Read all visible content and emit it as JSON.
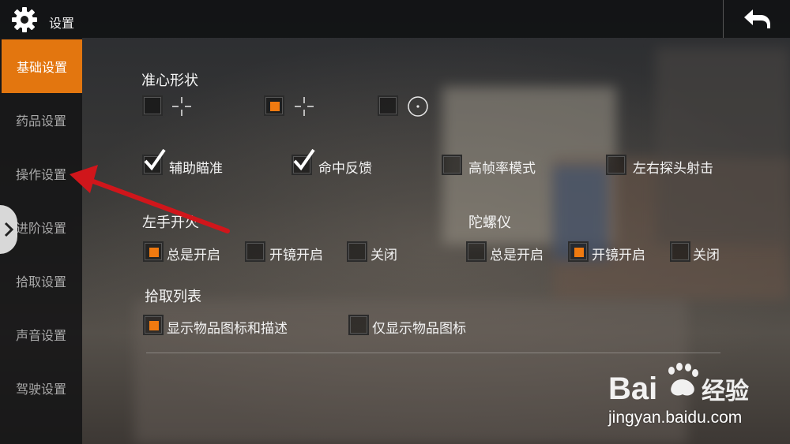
{
  "header": {
    "title": "设置",
    "back_icon": "back-arrow-icon",
    "settings_icon": "gear-icon"
  },
  "sidebar": {
    "items": [
      {
        "label": "基础设置",
        "active": true
      },
      {
        "label": "药品设置",
        "active": false
      },
      {
        "label": "操作设置",
        "active": false
      },
      {
        "label": "进阶设置",
        "active": false
      },
      {
        "label": "拾取设置",
        "active": false
      },
      {
        "label": "声音设置",
        "active": false
      },
      {
        "label": "驾驶设置",
        "active": false
      }
    ],
    "expand_icon": "chevron-right-icon"
  },
  "crosshair": {
    "title": "准心形状",
    "options": [
      {
        "icon": "crosshair-cross-icon",
        "selected": false
      },
      {
        "icon": "crosshair-cross-icon",
        "selected": true
      },
      {
        "icon": "crosshair-dot-circle-icon",
        "selected": false
      }
    ]
  },
  "toggles": [
    {
      "label": "辅助瞄准",
      "checked": true
    },
    {
      "label": "命中反馈",
      "checked": true
    },
    {
      "label": "高帧率模式",
      "checked": false
    },
    {
      "label": "左右探头射击",
      "checked": false
    }
  ],
  "left_fire": {
    "title": "左手开火",
    "options": [
      {
        "label": "总是开启",
        "selected": true
      },
      {
        "label": "开镜开启",
        "selected": false
      },
      {
        "label": "关闭",
        "selected": false
      }
    ]
  },
  "gyroscope": {
    "title": "陀螺仪",
    "options": [
      {
        "label": "总是开启",
        "selected": false
      },
      {
        "label": "开镜开启",
        "selected": true
      },
      {
        "label": "关闭",
        "selected": false
      }
    ]
  },
  "pickup_list": {
    "title": "拾取列表",
    "options": [
      {
        "label": "显示物品图标和描述",
        "selected": true
      },
      {
        "label": "仅显示物品图标",
        "selected": false
      }
    ]
  },
  "watermark": {
    "brand": "Bai 经验",
    "url": "jingyan.baidu.com"
  },
  "colors": {
    "accent": "#e3760f",
    "sidebar_bg": "#141416",
    "annotation_arrow": "#d0161b"
  }
}
